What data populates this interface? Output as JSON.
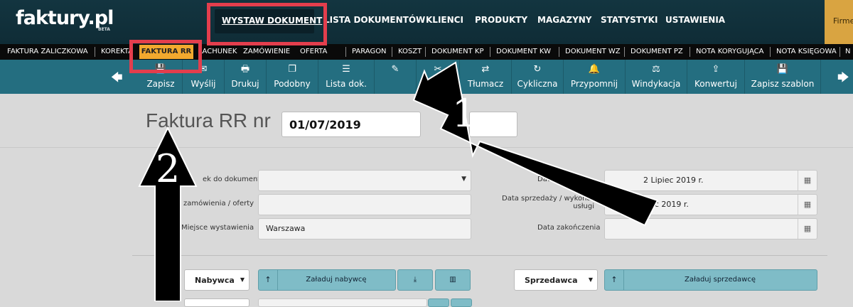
{
  "logo": {
    "text": "faktury.pl",
    "badge": "BETA"
  },
  "nav": [
    {
      "label": "WYSTAW DOKUMENT"
    },
    {
      "label": "LISTA DOKUMENTÓW"
    },
    {
      "label": "KLIENCI"
    },
    {
      "label": "PRODUKTY"
    },
    {
      "label": "MAGAZYNY"
    },
    {
      "label": "STATYSTYKI"
    },
    {
      "label": "USTAWIENIA"
    }
  ],
  "firma": "Firme",
  "doc_types": [
    "FAKTURA ZALICZKOWA",
    "KOREKTA",
    "FAKTURA RR",
    "RACHUNEK",
    "ZAMÓWIENIE",
    "OFERTA",
    "PARAGON",
    "KOSZT",
    "DOKUMENT KP",
    "DOKUMENT KW",
    "DOKUMENT WZ",
    "DOKUMENT PZ",
    "NOTA KORYGUJĄCA",
    "NOTA KSIĘGOWA",
    "N"
  ],
  "toolbar": [
    {
      "label": "Zapisz",
      "icon": "save-icon",
      "glyph": "💾"
    },
    {
      "label": "Wyślij",
      "icon": "send-icon",
      "glyph": "✉"
    },
    {
      "label": "Drukuj",
      "icon": "print-icon",
      "glyph": "🖶"
    },
    {
      "label": "Podobny",
      "icon": "copy-icon",
      "glyph": "❐"
    },
    {
      "label": "Lista dok.",
      "icon": "list-icon",
      "glyph": "☰"
    },
    {
      "label": "",
      "icon": "edit-icon",
      "glyph": "✎"
    },
    {
      "label": "",
      "icon": "tools-icon",
      "glyph": "✂"
    },
    {
      "label": "Tłumacz",
      "icon": "translate-icon",
      "glyph": "⇄"
    },
    {
      "label": "Cykliczna",
      "icon": "cycle-icon",
      "glyph": "↻"
    },
    {
      "label": "Przypomnij",
      "icon": "bell-icon",
      "glyph": "🔔"
    },
    {
      "label": "Windykacja",
      "icon": "gavel-icon",
      "glyph": "⚖"
    },
    {
      "label": "Konwertuj",
      "icon": "upload-icon",
      "glyph": "⇪"
    },
    {
      "label": "Zapisz szablon",
      "icon": "save-template-icon",
      "glyph": "💾"
    }
  ],
  "doc": {
    "title": "Faktura RR nr",
    "number": "01/07/2019"
  },
  "fields": {
    "link_label": "ek do dokumentu",
    "order_label": "zamówienia / oferty",
    "place_label": "Miejsce wystawienia",
    "place_value": "Warszawa",
    "issue_label": "Data wy",
    "issue_value": "2 Lipiec 2019 r.",
    "sale_label_1": "Data sprzedaży / wykonania",
    "sale_label_2": "usługi",
    "sale_value_a": "W",
    "sale_value_b": "iec 2019 r.",
    "end_label": "Data zakończenia"
  },
  "parties": {
    "buyer_select": "Nabywca",
    "load_buyer": "Załaduj nabywcę",
    "seller_select": "Sprzedawca",
    "load_seller": "Załaduj sprzedawcę"
  },
  "annotations": [
    "1",
    "2"
  ],
  "colors": {
    "topbar": "#133540",
    "toolbar": "#246e80",
    "active_tab": "#f2a92e",
    "highlight": "#e33e4d"
  }
}
